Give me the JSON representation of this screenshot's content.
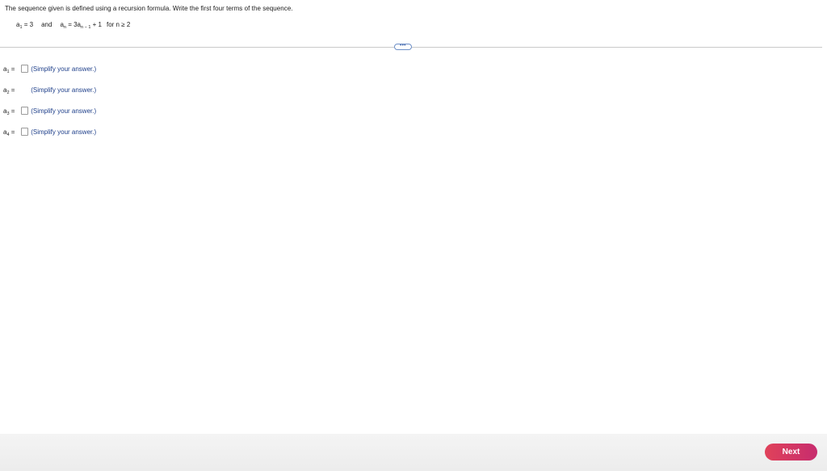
{
  "question": {
    "instruction": "The sequence given is defined using a recursion formula. Write the first four terms of the sequence.",
    "formula": {
      "base_var": "a",
      "base_sub": "1",
      "base_eq": "= 3",
      "and": "and",
      "rec_lhs_var": "a",
      "rec_lhs_sub": "n",
      "rec_eq": "= 3a",
      "rec_rhs_sub": "n − 1",
      "rec_tail": "+ 1",
      "condition": "for n ≥ 2"
    }
  },
  "toolbar": {
    "more_label": "•••"
  },
  "answers": [
    {
      "var": "a",
      "sub": "1",
      "eq": "=",
      "value": "",
      "hint": "(Simplify your answer.)"
    },
    {
      "var": "a",
      "sub": "2",
      "eq": "=",
      "value": "",
      "hint": "(Simplify your answer.)"
    },
    {
      "var": "a",
      "sub": "3",
      "eq": "=",
      "value": "",
      "hint": "(Simplify your answer.)"
    },
    {
      "var": "a",
      "sub": "4",
      "eq": "=",
      "value": "",
      "hint": "(Simplify your answer.)"
    }
  ],
  "footer": {
    "next_label": "Next"
  }
}
